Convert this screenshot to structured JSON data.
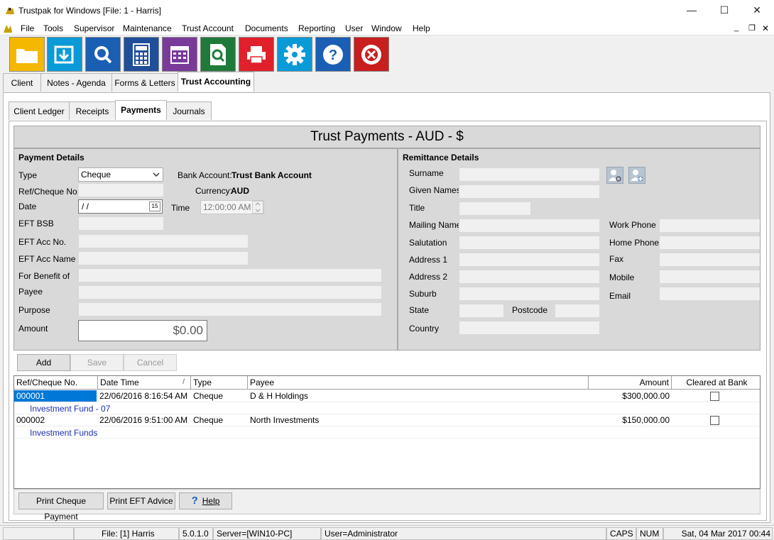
{
  "window": {
    "title": "Trustpak for Windows [File: 1 - Harris]",
    "minimize": "—",
    "maximize": "☐",
    "close": "✕",
    "mdi_min": "_",
    "mdi_restore": "❐",
    "mdi_close": "✕"
  },
  "menu": [
    "File",
    "Tools",
    "Supervisor",
    "Maintenance",
    "Trust Account",
    "Documents",
    "Reporting",
    "User",
    "Window",
    "Help"
  ],
  "toolbar": {
    "colors": [
      "#f5b800",
      "#0a9ad8",
      "#1a5fb4",
      "#1f4e9a",
      "#7a3a9a",
      "#1f7a3a",
      "#e0202a",
      "#0a9ad8",
      "#1a5fb4",
      "#c81e1e"
    ],
    "icons": [
      "folder-icon",
      "import-icon",
      "search-icon",
      "calculator-icon",
      "calendar-icon",
      "document-search-icon",
      "print-icon",
      "settings-icon",
      "help-icon",
      "exit-icon"
    ]
  },
  "main_tabs": [
    "Client",
    "Notes - Agenda",
    "Forms & Letters",
    "Trust Accounting"
  ],
  "sub_tabs": [
    "Client Ledger",
    "Receipts",
    "Payments",
    "Journals"
  ],
  "header_title": "Trust Payments - AUD - $",
  "payment": {
    "section": "Payment Details",
    "type_label": "Type",
    "type_value": "Cheque",
    "bank_account_label": "Bank Account:",
    "bank_account_value": "Trust Bank Account",
    "ref_label": "Ref/Cheque No.",
    "currency_label": "Currency:",
    "currency_value": "AUD",
    "date_label": "Date",
    "date_value": " /  /",
    "date_btn": "15",
    "time_label": "Time",
    "time_value": "12:00:00 AM",
    "eft_bsb_label": "EFT BSB",
    "eft_acc_no_label": "EFT Acc No.",
    "eft_acc_name_label": "EFT Acc Name",
    "for_benefit_label": "For Benefit of",
    "payee_label": "Payee",
    "purpose_label": "Purpose",
    "amount_label": "Amount",
    "amount_value": "$0.00"
  },
  "remittance": {
    "section": "Remittance Details",
    "surname": "Surname",
    "given_names": "Given Names",
    "title": "Title",
    "mailing_name": "Mailing Name",
    "salutation": "Salutation",
    "address1": "Address 1",
    "address2": "Address 2",
    "suburb": "Suburb",
    "state": "State",
    "postcode": "Postcode",
    "country": "Country",
    "work_phone": "Work Phone",
    "home_phone": "Home Phone",
    "fax": "Fax",
    "mobile": "Mobile",
    "email": "Email"
  },
  "actions": {
    "add": "Add",
    "save": "Save",
    "cancel": "Cancel"
  },
  "grid": {
    "headers": [
      "Ref/Cheque No.",
      "Date Time",
      "Type",
      "Payee",
      "Amount",
      "Cleared at Bank"
    ],
    "sort_glyph": "/",
    "rows": [
      {
        "ref": "000001",
        "datetime": "22/06/2016 8:16:54 AM",
        "type": "Cheque",
        "payee": "D & H Holdings",
        "amount": "$300,000.00",
        "memo": "Investment Fund - 07"
      },
      {
        "ref": "000002",
        "datetime": "22/06/2016 9:51:00 AM",
        "type": "Cheque",
        "payee": "North Investments",
        "amount": "$150,000.00",
        "memo": "Investment Funds"
      }
    ]
  },
  "bottom_buttons": {
    "print_cheque": "Print Cheque Payment",
    "print_eft": "Print EFT Advice",
    "help": "Help",
    "help_glyph": "?"
  },
  "status": {
    "file": "File: [1] Harris",
    "version": "5.0.1.0",
    "server": "Server=[WIN10-PC]",
    "user": "User=Administrator",
    "caps": "CAPS",
    "num": "NUM",
    "datetime": "Sat, 04 Mar 2017 00:44"
  }
}
